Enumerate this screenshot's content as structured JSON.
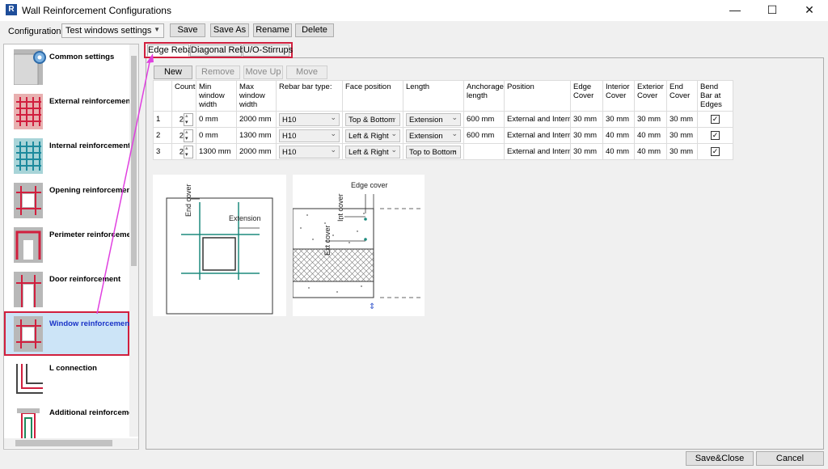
{
  "window": {
    "app_icon": "R",
    "title": "Wall Reinforcement Configurations",
    "minimize": "—",
    "maximize": "☐",
    "close": "✕"
  },
  "config_bar": {
    "label": "Configuration",
    "colon": ":",
    "selected": "Test windows settings",
    "buttons": {
      "save": "Save",
      "save_as": "Save As",
      "rename": "Rename",
      "delete": "Delete"
    }
  },
  "sidebar": {
    "items": [
      {
        "label": "Common settings",
        "icon": "gear-wall-icon"
      },
      {
        "label": "External reinforcement",
        "icon": "external-mesh-icon"
      },
      {
        "label": "Internal reinforcement",
        "icon": "internal-mesh-icon"
      },
      {
        "label": "Opening reinforcement",
        "icon": "opening-icon"
      },
      {
        "label": "Perimeter reinforcement",
        "icon": "perimeter-icon"
      },
      {
        "label": "Door reinforcement",
        "icon": "door-icon"
      },
      {
        "label": "Window reinforcement",
        "icon": "window-icon",
        "selected": true
      },
      {
        "label": "L connection",
        "icon": "l-connection-icon"
      },
      {
        "label": "Additional reinforcement",
        "icon": "additional-icon"
      }
    ]
  },
  "tabs": [
    "Edge Rebar",
    "Diagonal Rebar",
    "U/O-Stirrups"
  ],
  "toolbar": {
    "new": "New Item",
    "remove": "Remove Item",
    "up": "Move Up",
    "down": "Move Down"
  },
  "table": {
    "headers": [
      "",
      "Count",
      "Min window width",
      "Max window width",
      "Rebar bar type:",
      "Face position",
      "Length",
      "Anchorage length",
      "Position",
      "Edge Cover",
      "Interior Cover",
      "Exterior Cover",
      "End Cover",
      "Bend Bar at Edges"
    ],
    "rows": [
      {
        "n": "1",
        "count": "2",
        "min": "0 mm",
        "max": "2000 mm",
        "bar": "H10",
        "face": "Top & Bottom",
        "length": "Extension",
        "anchor": "600 mm",
        "position": "External and Internal",
        "edge": "30 mm",
        "interior": "30 mm",
        "exterior": "30 mm",
        "end": "30 mm",
        "bend": "✓"
      },
      {
        "n": "2",
        "count": "2",
        "min": "0 mm",
        "max": "1300 mm",
        "bar": "H10",
        "face": "Left & Right",
        "length": "Extension",
        "anchor": "600 mm",
        "position": "External and Internal",
        "edge": "30 mm",
        "interior": "40 mm",
        "exterior": "40 mm",
        "end": "30 mm",
        "bend": "✓"
      },
      {
        "n": "3",
        "count": "2",
        "min": "1300 mm",
        "max": "2000 mm",
        "bar": "H10",
        "face": "Left & Right",
        "length": "Top to Bottom",
        "anchor": "",
        "position": "External and Internal",
        "edge": "30 mm",
        "interior": "40 mm",
        "exterior": "40 mm",
        "end": "30 mm",
        "bend": "✓"
      }
    ]
  },
  "diagram_labels": {
    "end_cover": "End cover",
    "extension": "Extension",
    "edge_cover": "Edge cover",
    "int_cover": "Int cover",
    "ext_cover": "Ext cover"
  },
  "footer": {
    "save_close": "Save&Close",
    "cancel": "Cancel"
  },
  "colors": {
    "highlight": "#d11f3e",
    "arrow": "#e040e0",
    "rebar": "#1d8a7d",
    "selected_bg": "#cce4f7",
    "selected_text": "#1a33c7"
  }
}
